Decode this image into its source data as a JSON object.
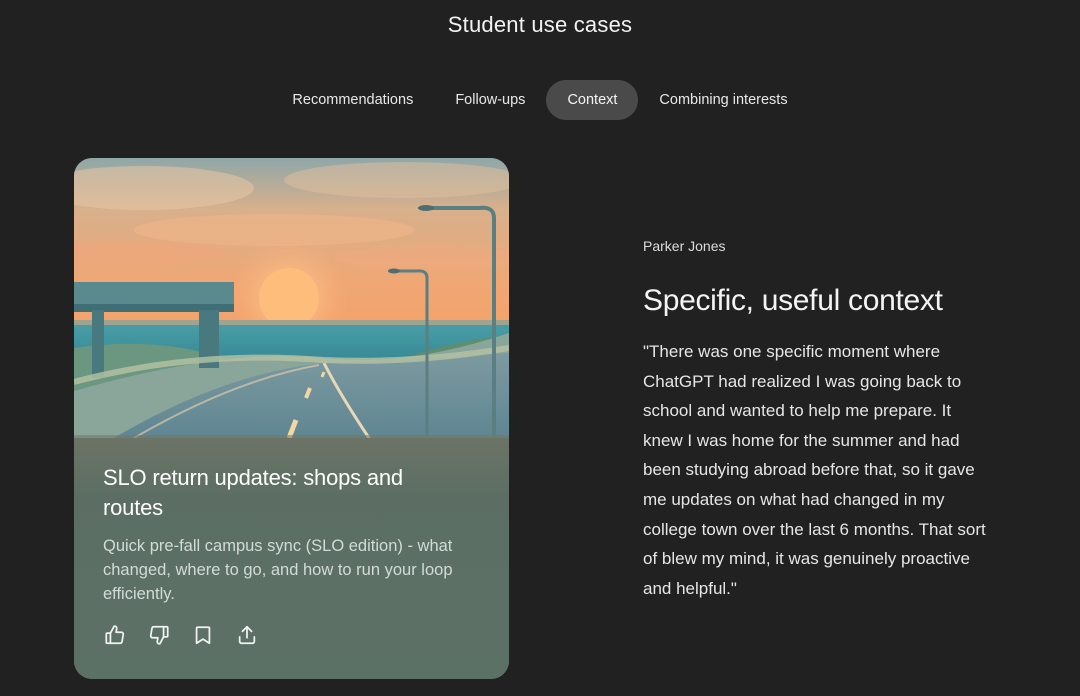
{
  "page": {
    "title": "Student use cases"
  },
  "tabs": [
    {
      "label": "Recommendations",
      "active": false
    },
    {
      "label": "Follow-ups",
      "active": false
    },
    {
      "label": "Context",
      "active": true
    },
    {
      "label": "Combining interests",
      "active": false
    }
  ],
  "card": {
    "title": "SLO return updates: shops and routes",
    "description": "Quick pre-fall campus sync (SLO edition) - what changed, where to go, and how to run your loop efficiently.",
    "actions": [
      {
        "icon": "thumbs-up-icon"
      },
      {
        "icon": "thumbs-down-icon"
      },
      {
        "icon": "bookmark-icon"
      },
      {
        "icon": "share-icon"
      }
    ]
  },
  "quote": {
    "author": "Parker Jones",
    "heading": "Specific, useful context",
    "text": "\"There was one specific moment where ChatGPT had realized I was going back to school and wanted to help me prepare. It knew I was home for the summer and had been studying abroad before that, so it gave me updates on what had changed in my college town over the last 6 months. That sort of blew my mind, it was genuinely proactive and helpful.\""
  },
  "colors": {
    "background": "#212121",
    "active_tab": "#4a4a4a",
    "card_panel": "#5c7166"
  }
}
